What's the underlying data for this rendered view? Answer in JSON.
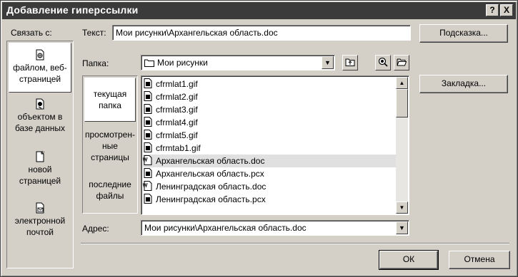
{
  "dialog": {
    "title": "Добавление гиперссылки",
    "help_button": "?",
    "close_button": "X"
  },
  "link_to": {
    "label": "Связать с:",
    "items": [
      {
        "label": "файлом, веб-\nстраницей",
        "icon": "globe-file-icon",
        "selected": true
      },
      {
        "label": "объектом в\nбазе данных",
        "icon": "database-object-icon",
        "selected": false
      },
      {
        "label": "новой\nстраницей",
        "icon": "new-page-icon",
        "selected": false
      },
      {
        "label": "электронной\nпочтой",
        "icon": "email-icon",
        "selected": false
      }
    ]
  },
  "text_field": {
    "label": "Текст:",
    "value": "Мои рисунки\\Архангельская область.doc"
  },
  "buttons": {
    "tooltip": "Подсказка...",
    "bookmark": "Закладка...",
    "ok": "ОК",
    "cancel": "Отмена"
  },
  "folder": {
    "label": "Папка:",
    "value": "Мои рисунки",
    "icon": "folder-icon"
  },
  "places": [
    {
      "label": "текущая\nпапка",
      "selected": true
    },
    {
      "label": "просмотрен-\nные\nстраницы",
      "selected": false
    },
    {
      "label": "последние\nфайлы",
      "selected": false
    }
  ],
  "files": [
    {
      "name": "cfrmlat1.gif",
      "icon": "image-file-icon",
      "selected": false
    },
    {
      "name": "cfrmlat2.gif",
      "icon": "image-file-icon",
      "selected": false
    },
    {
      "name": "cfrmlat3.gif",
      "icon": "image-file-icon",
      "selected": false
    },
    {
      "name": "cfrmlat4.gif",
      "icon": "image-file-icon",
      "selected": false
    },
    {
      "name": "cfrmlat5.gif",
      "icon": "image-file-icon",
      "selected": false
    },
    {
      "name": "cfrmtab1.gif",
      "icon": "image-file-icon",
      "selected": false
    },
    {
      "name": "Архангельская область.doc",
      "icon": "word-document-icon",
      "selected": true
    },
    {
      "name": "Архангельская область.pcx",
      "icon": "image-file-icon",
      "selected": false
    },
    {
      "name": "Ленинградская область.doc",
      "icon": "word-document-icon",
      "selected": false
    },
    {
      "name": "Ленинградская область.pcx",
      "icon": "image-file-icon",
      "selected": false
    }
  ],
  "address": {
    "label": "Адрес:",
    "value": "Мои рисунки\\Архангельская область.doc"
  },
  "colors": {
    "dialog_bg": "#d4d0c8",
    "titlebar_bg": "#3b3b3b",
    "selection_bg": "#e0e0e0"
  }
}
